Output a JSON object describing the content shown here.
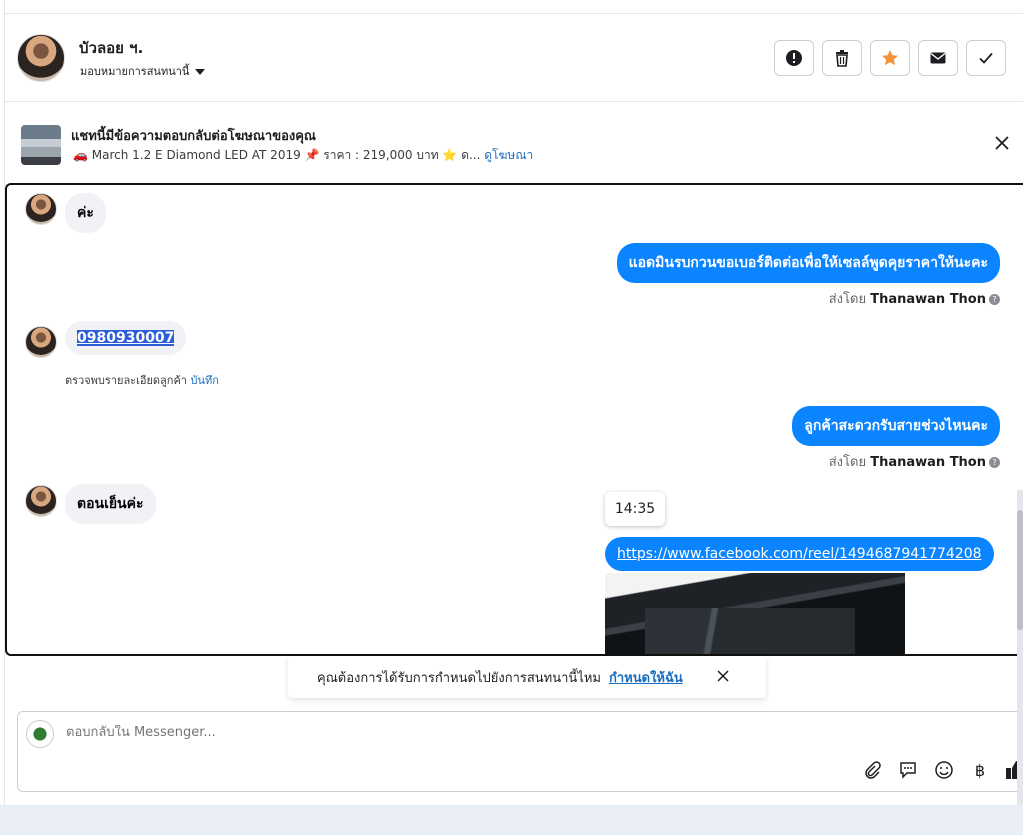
{
  "header": {
    "name": "บัวลอย ฯ.",
    "assign_label": "มอบหมายการสนทนานี้",
    "actions": [
      "spam",
      "delete",
      "star",
      "mark-unread",
      "done"
    ]
  },
  "ad": {
    "title": "แชทนี้มีข้อความตอบกลับต่อโฆษณาของคุณ",
    "subtitle": "🚗 March 1.2 E Diamond LED AT 2019 📌 ราคา : 219,000 บาท ⭐ ด...",
    "link": "ดูโฆษณา"
  },
  "messages": {
    "m1": "ค่ะ",
    "m2": "แอดมินรบกวนขอเบอร์ติดต่อเพื่อให้เซลล์พูดคุยราคาให้นะคะ",
    "m3": "0980930007",
    "m4": "ลูกค้าสะดวกรับสายช่วงไหนคะ",
    "m5": "ตอนเย็นค่ะ",
    "m6": "https://www.facebook.com/reel/1494687941774208"
  },
  "sent_by": {
    "prefix": "ส่งโดย",
    "agent": "Thanawan Thon"
  },
  "detail_note": {
    "text": "ตรวจพบรายละเอียดลูกค้า",
    "link": "บันทึก"
  },
  "tooltip_time": "14:35",
  "suggest": {
    "text": "คุณต้องการได้รับการกำหนดไปยังการสนทนานี้ไหม",
    "action": "กำหนดให้ฉัน"
  },
  "composer": {
    "placeholder": "ตอบกลับใน Messenger..."
  },
  "colors": {
    "outgoing": "#0b84ff",
    "incoming": "#f0f2f5",
    "star": "#f7923a",
    "link": "#1a6ec2"
  }
}
